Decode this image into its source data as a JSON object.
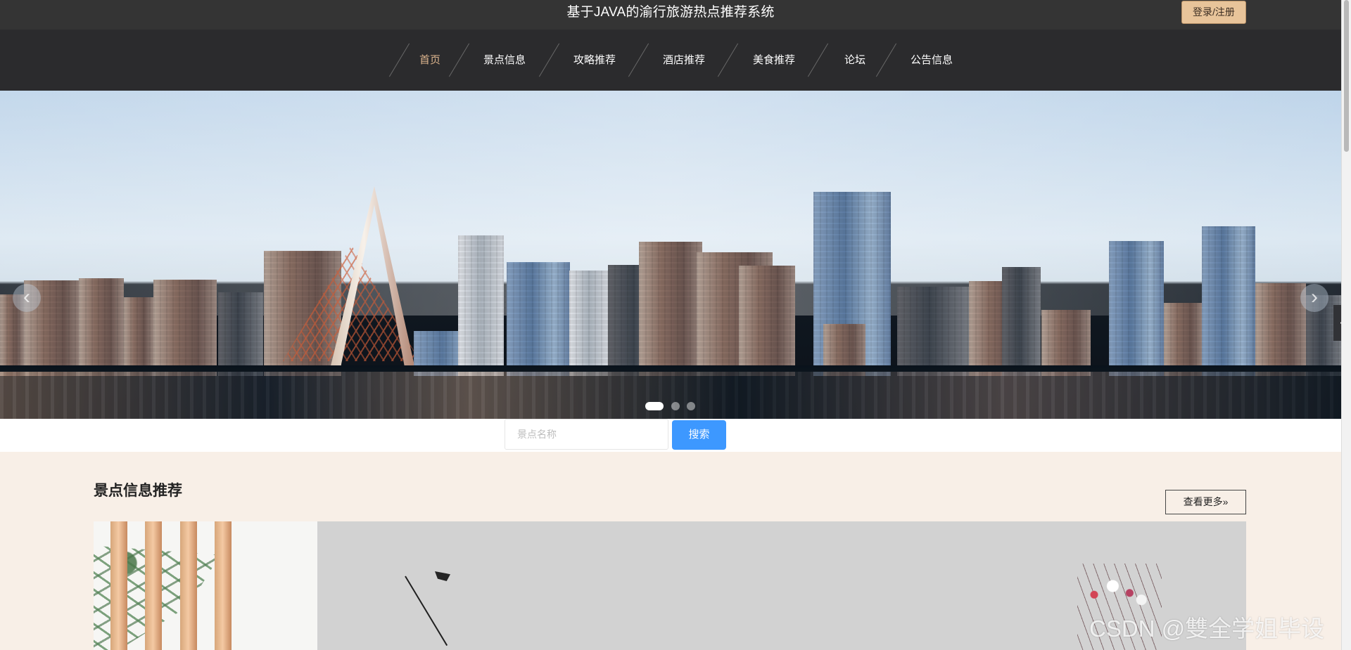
{
  "header": {
    "title": "基于JAVA的渝行旅游热点推荐系统",
    "login_label": "登录/注册"
  },
  "nav": {
    "items": [
      {
        "label": "首页",
        "active": true
      },
      {
        "label": "景点信息",
        "active": false
      },
      {
        "label": "攻略推荐",
        "active": false
      },
      {
        "label": "酒店推荐",
        "active": false
      },
      {
        "label": "美食推荐",
        "active": false
      },
      {
        "label": "论坛",
        "active": false
      },
      {
        "label": "公告信息",
        "active": false
      }
    ]
  },
  "hero": {
    "prev_icon": "chevron-left-icon",
    "next_icon": "chevron-right-icon",
    "dots": [
      {
        "active": true
      },
      {
        "active": false
      },
      {
        "active": false
      }
    ],
    "side_handle_icon": "chevron-left-icon"
  },
  "search": {
    "placeholder": "景点名称",
    "button_label": "搜索"
  },
  "section": {
    "title": "景点信息推荐",
    "more_label": "查看更多»"
  },
  "watermark": {
    "text": "CSDN @雙全学姐毕设"
  },
  "colors": {
    "header_background": "#343434",
    "nav_background": "#2b2b2d",
    "active_nav": "#dcb48d",
    "login_button": "#e8c49a",
    "search_button": "#3d98ff",
    "page_background": "#f8efe7"
  }
}
